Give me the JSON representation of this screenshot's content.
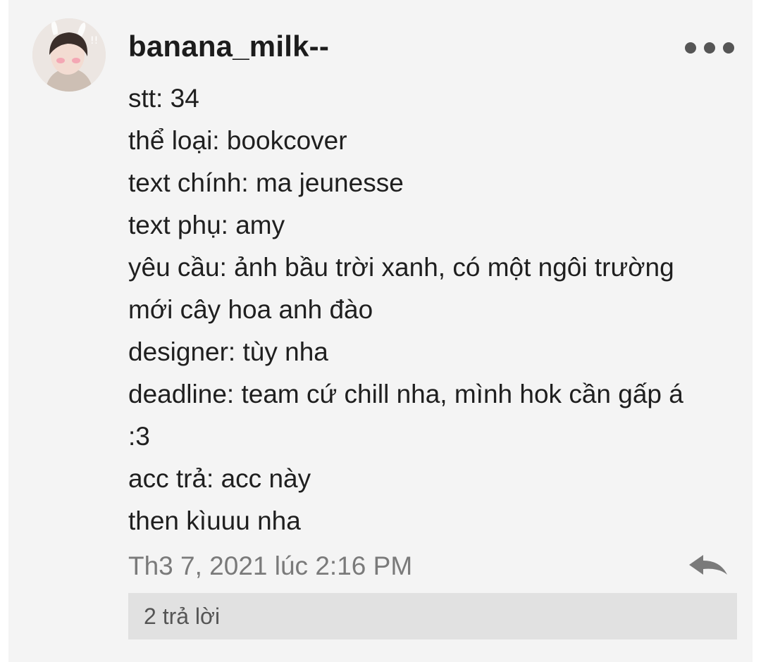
{
  "comment": {
    "username": "banana_milk--",
    "avatar_icon": "user-avatar",
    "more_icon": "more-horizontal-icon",
    "lines": [
      "stt: 34",
      "thể loại: bookcover",
      "text chính: ma jeunesse",
      "text phụ: amy",
      "yêu cầu: ảnh bầu trời xanh, có một ngôi trường",
      "mới cây hoa anh đào",
      "designer: tùy nha",
      "deadline: team cứ chill nha, mình hok cần gấp á",
      ":3",
      "acc trả: acc này",
      "then kìuuu nha"
    ],
    "timestamp": "Th3 7, 2021 lúc 2:16 PM",
    "reply_icon": "reply-arrow-icon",
    "replies_label": "2 trả lời"
  },
  "colors": {
    "card_background": "#f4f4f4",
    "text": "#1f1f1f",
    "muted_text": "#7a7a7a",
    "replies_background": "#e1e1e1"
  }
}
